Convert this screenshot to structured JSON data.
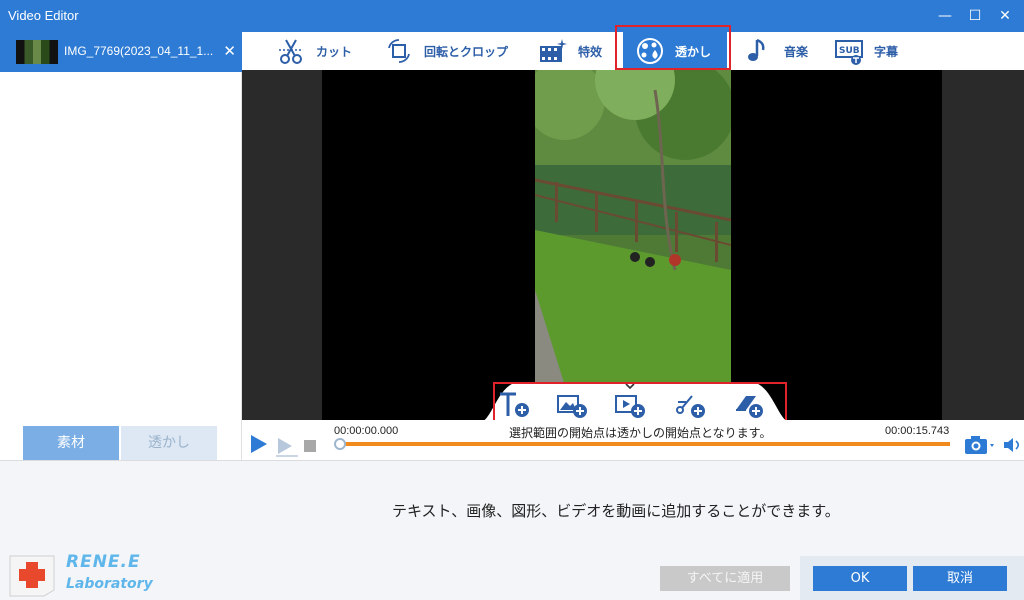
{
  "window": {
    "title": "Video Editor",
    "minimize": "—",
    "maximize": "☐",
    "close": "✕"
  },
  "files": [
    {
      "name": "IMG_7769(2023_04_11_1...",
      "close": "✕"
    }
  ],
  "left_tabs": [
    {
      "label": "素材"
    },
    {
      "label": "透かし"
    }
  ],
  "toolbar": [
    {
      "label": "カット",
      "icon": "cut-icon"
    },
    {
      "label": "回転とクロップ",
      "icon": "rotate-crop-icon"
    },
    {
      "label": "特效",
      "icon": "effects-icon"
    },
    {
      "label": "透かし",
      "icon": "watermark-icon",
      "active": true
    },
    {
      "label": "音楽",
      "icon": "music-icon"
    },
    {
      "label": "字幕",
      "icon": "subtitle-icon"
    }
  ],
  "watermark_tools": [
    {
      "name": "add-text-watermark",
      "icon": "text-plus-icon"
    },
    {
      "name": "add-image-watermark",
      "icon": "image-plus-icon"
    },
    {
      "name": "add-video-watermark",
      "icon": "video-plus-icon"
    },
    {
      "name": "add-shape-watermark",
      "icon": "shape-plus-icon"
    },
    {
      "name": "add-eraser",
      "icon": "eraser-plus-icon"
    }
  ],
  "timeline": {
    "start_time": "00:00:00.000",
    "end_time": "00:00:15.743",
    "message": "選択範囲の開始点は透かしの開始点となります。",
    "progress": 0
  },
  "hint": "テキスト、画像、図形、ビデオを動画に追加することができます。",
  "buttons": {
    "apply_all": "すべてに適用",
    "ok": "OK",
    "cancel": "取消"
  },
  "brand": {
    "line1": "RENE.E",
    "line2": "Laboratory"
  },
  "colors": {
    "accent": "#2d7bd4",
    "highlight": "#e0222a",
    "timeline": "#f08a1c"
  }
}
